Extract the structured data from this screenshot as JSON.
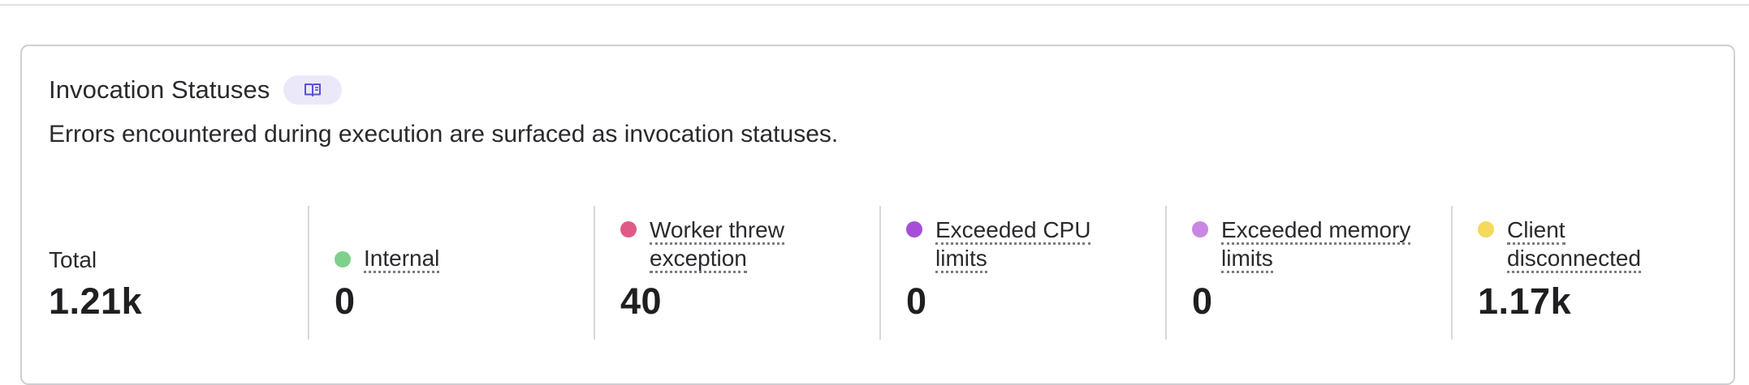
{
  "card": {
    "title": "Invocation Statuses",
    "docs_icon": "book-icon",
    "description": "Errors encountered during execution are surfaced as invocation statuses."
  },
  "stats": [
    {
      "label_lines": [
        "Total"
      ],
      "value": "1.21k",
      "dot_color": null
    },
    {
      "label_lines": [
        "Internal"
      ],
      "value": "0",
      "dot_color": "#7fd08d"
    },
    {
      "label_lines": [
        "Worker threw",
        "exception"
      ],
      "value": "40",
      "dot_color": "#e05a86"
    },
    {
      "label_lines": [
        "Exceeded CPU",
        "limits"
      ],
      "value": "0",
      "dot_color": "#a64fd6"
    },
    {
      "label_lines": [
        "Exceeded memory",
        "limits"
      ],
      "value": "0",
      "dot_color": "#c986e4"
    },
    {
      "label_lines": [
        "Client",
        "disconnected"
      ],
      "value": "1.17k",
      "dot_color": "#f5d95a"
    }
  ],
  "colors": {
    "border": "#cfcfd3",
    "badge_bg": "#ebe9f9",
    "badge_icon": "#5b4fd6"
  }
}
